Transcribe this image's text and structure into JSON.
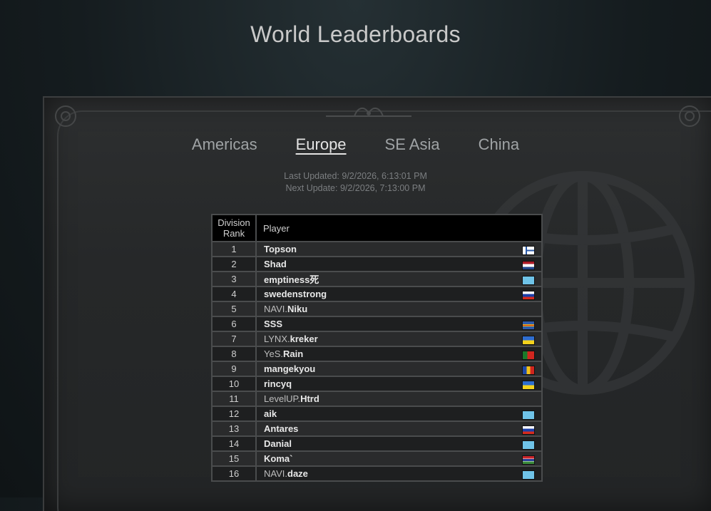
{
  "page": {
    "title": "World Leaderboards"
  },
  "regions": [
    {
      "label": "Americas",
      "active": false
    },
    {
      "label": "Europe",
      "active": true
    },
    {
      "label": "SE Asia",
      "active": false
    },
    {
      "label": "China",
      "active": false
    }
  ],
  "update": {
    "last": "Last Updated: 9/2/2026, 6:13:01 PM",
    "next": "Next Update: 9/2/2026, 7:13:00 PM"
  },
  "table": {
    "headers": {
      "rank_line1": "Division",
      "rank_line2": "Rank",
      "player": "Player"
    },
    "rows": [
      {
        "rank": "1",
        "team": "",
        "name": "Topson",
        "flag": "finland-flag-icon"
      },
      {
        "rank": "2",
        "team": "",
        "name": "Shad",
        "flag": "netherlands-flag-icon"
      },
      {
        "rank": "3",
        "team": "",
        "name": "emptiness死",
        "flag": "kazakhstan-flag-icon"
      },
      {
        "rank": "4",
        "team": "",
        "name": "swedenstrong",
        "flag": "russia-flag-icon"
      },
      {
        "rank": "5",
        "team": "NAVI.",
        "name": "Niku",
        "flag": ""
      },
      {
        "rank": "6",
        "team": "",
        "name": "SSS",
        "flag": "aland-flag-icon"
      },
      {
        "rank": "7",
        "team": "LYNX.",
        "name": "kreker",
        "flag": "ukraine-flag-icon"
      },
      {
        "rank": "8",
        "team": "YeS.",
        "name": "Rain",
        "flag": "portugal-flag-icon"
      },
      {
        "rank": "9",
        "team": "",
        "name": "mangekyou",
        "flag": "moldova-flag-icon"
      },
      {
        "rank": "10",
        "team": "",
        "name": "rincyq",
        "flag": "ukraine-flag-icon"
      },
      {
        "rank": "11",
        "team": "LevelUP.",
        "name": "Htrd",
        "flag": ""
      },
      {
        "rank": "12",
        "team": "",
        "name": "aik",
        "flag": "kazakhstan-flag-icon"
      },
      {
        "rank": "13",
        "team": "",
        "name": "Antares",
        "flag": "russia-flag-icon"
      },
      {
        "rank": "14",
        "team": "",
        "name": "Danial",
        "flag": "kazakhstan-flag-icon"
      },
      {
        "rank": "15",
        "team": "",
        "name": "Koma`",
        "flag": "gambia-flag-icon"
      },
      {
        "rank": "16",
        "team": "NAVI.",
        "name": "daze",
        "flag": "kazakhstan-flag-icon"
      }
    ]
  }
}
